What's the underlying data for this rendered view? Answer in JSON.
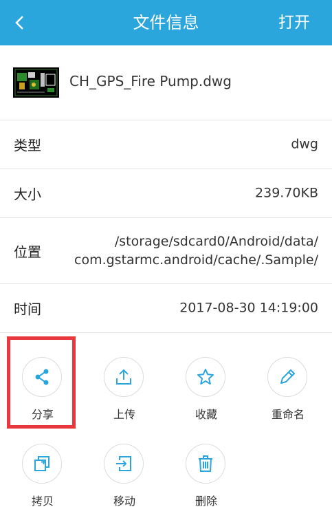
{
  "header": {
    "title": "文件信息",
    "open_label": "打开"
  },
  "file": {
    "name": "CH_GPS_Fire Pump.dwg"
  },
  "info": {
    "type": {
      "label": "类型",
      "value": "dwg"
    },
    "size": {
      "label": "大小",
      "value": "239.70KB"
    },
    "location": {
      "label": "位置",
      "value_line1": "/storage/sdcard0/Android/data/",
      "value_line2": "com.gstarmc.android/cache/.Sample/"
    },
    "time": {
      "label": "时间",
      "value": "2017-08-30 14:19:00"
    }
  },
  "actions": {
    "share": "分享",
    "upload": "上传",
    "favorite": "收藏",
    "rename": "重命名",
    "copy": "拷贝",
    "move": "移动",
    "delete": "删除"
  },
  "colors": {
    "accent": "#2aa6dc",
    "highlight": "#e8373f"
  }
}
